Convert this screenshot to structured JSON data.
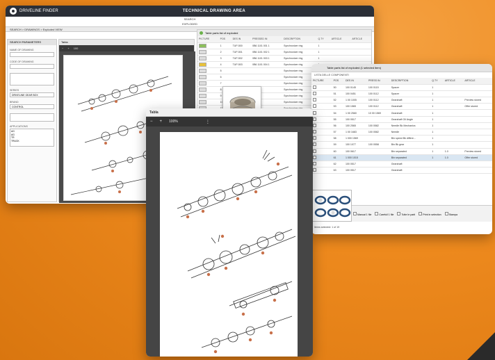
{
  "main": {
    "brand": "DRIVELINE FINDER",
    "title": "TECHNICAL DRAWING AREA",
    "subtitle_1": "SEARCH",
    "subtitle_2": "EXPLODED",
    "breadcrumb": "SEARCH  >  DRAWINGS  >  Exploded VIEW",
    "sidebar": {
      "header": "SEARCH PARAMETERS",
      "fields": [
        "NAME OF DRAWING",
        "CODE OF DRAWING",
        "",
        "SERIES",
        "BRAND",
        ""
      ],
      "series_value": "DRIVELINE GEAR BOX",
      "brand_value": "CONTROL",
      "apps_label": "APPLICATIONS",
      "apps": [
        "AG",
        "AG",
        "TR",
        "TRUCK"
      ]
    },
    "drawing_pane": {
      "tab": "Tabla",
      "zoom": "100"
    },
    "table_pane": {
      "header": "Table parts list of exploded",
      "columns": [
        "PICTURE",
        "POS",
        "DES IN",
        "PRESSED IN",
        "DESCRIPTION",
        "Q.TY",
        "ARTICLE",
        "ARTICLE"
      ],
      "rows": [
        {
          "thumb": "g",
          "pos": "1",
          "des": "TUP-500",
          "code": "0B6 1101 001 1",
          "desc": "Synchronizer ring",
          "qty": "1"
        },
        {
          "thumb": "",
          "pos": "2",
          "des": "TUP-501",
          "code": "0B6 1101 002 1",
          "desc": "Synchronizer ring",
          "qty": "1"
        },
        {
          "thumb": "",
          "pos": "3",
          "des": "TUP-502",
          "code": "0B6 1101 003 1",
          "desc": "Synchronizer ring",
          "qty": "1"
        },
        {
          "thumb": "y",
          "pos": "4",
          "des": "TUP-503",
          "code": "0B6 1101 004 1",
          "desc": "Synchronizer ring",
          "qty": "1"
        },
        {
          "thumb": "",
          "pos": "5",
          "des": "",
          "code": "",
          "desc": "Synchronizer ring",
          "qty": ""
        },
        {
          "thumb": "",
          "pos": "6",
          "des": "",
          "code": "",
          "desc": "Synchronizer ring",
          "qty": ""
        },
        {
          "thumb": "",
          "pos": "7",
          "des": "",
          "code": "",
          "desc": "Synchronizer ring",
          "qty": ""
        },
        {
          "thumb": "",
          "pos": "8",
          "des": "",
          "code": "",
          "desc": "Synchronizer ring",
          "qty": ""
        },
        {
          "thumb": "",
          "pos": "9",
          "des": "",
          "code": "",
          "desc": "Synchronizer ring",
          "qty": ""
        },
        {
          "thumb": "",
          "pos": "10",
          "des": "",
          "code": "",
          "desc": "Synchronizer ring",
          "qty": ""
        },
        {
          "thumb": "",
          "pos": "11",
          "des": "",
          "code": "",
          "desc": "Synchronizer ring",
          "qty": ""
        },
        {
          "thumb": "",
          "pos": "12",
          "des": "",
          "code": "",
          "desc": "Synchronizer ring",
          "qty": ""
        },
        {
          "thumb": "",
          "pos": "13",
          "des": "",
          "code": "",
          "desc": "Synchronizer ring",
          "qty": ""
        }
      ]
    }
  },
  "detail": {
    "header": "Table parts list of exploded (1 selected item)",
    "subheader": "LISTA DELLE COMPONENTI",
    "columns": [
      "PICTURE",
      "POS",
      "DES IN",
      "PRESS IN",
      "DESCRIPTION",
      "Q.TY",
      "ARTICLE",
      "ARTICLE"
    ],
    "rows": [
      {
        "pos": "50",
        "des": "100 0145",
        "press": "100 0115",
        "desc": "Spacer",
        "qty": "1",
        "art1": "",
        "art2": ""
      },
      {
        "pos": "51",
        "des": "100 0451",
        "press": "100 0112",
        "desc": "Spacer",
        "qty": "1",
        "art1": "",
        "art2": ""
      },
      {
        "pos": "52",
        "des": "1 00 1005",
        "press": "100 0112",
        "desc": "Gearshaft",
        "qty": "1",
        "art1": "",
        "art2": "Preview stored"
      },
      {
        "pos": "53",
        "des": "100 1565",
        "press": "100 0112",
        "desc": "Gearshaft",
        "qty": "1",
        "art1": "",
        "art2": "Offer stored"
      },
      {
        "pos": "54",
        "des": "1 00 2560",
        "press": "10 00 1569",
        "desc": "Gearshaft",
        "qty": "1",
        "art1": "",
        "art2": ""
      },
      {
        "pos": "55",
        "des": "100 0517",
        "press": "",
        "desc": "Gearshaft Oil Angle",
        "qty": "1",
        "art1": "",
        "art2": ""
      },
      {
        "pos": "56",
        "des": "100 2565",
        "press": "100 0582",
        "desc": "Needle Bk Mechanics",
        "qty": "1",
        "art1": "",
        "art2": ""
      },
      {
        "pos": "57",
        "des": "1 00 1683",
        "press": "100 0582",
        "desc": "Needle",
        "qty": "1",
        "art1": "",
        "art2": ""
      },
      {
        "pos": "58",
        "des": "1 000 1569",
        "press": "",
        "desc": "Bin speed Bk differe...",
        "qty": "1",
        "art1": "",
        "art2": ""
      },
      {
        "pos": "59",
        "des": "100 1077",
        "press": "100 0558",
        "desc": "Bin Bk gear",
        "qty": "1",
        "art1": "",
        "art2": ""
      },
      {
        "pos": "60",
        "des": "100 0617",
        "press": "",
        "desc": "Bin separated",
        "qty": "1",
        "art1": "1.0",
        "art2": "Preview stored"
      },
      {
        "pos": "61",
        "des": "1 000 1015",
        "press": "",
        "desc": "Bin separated",
        "qty": "1",
        "art1": "1.0",
        "art2": "Offer stored"
      },
      {
        "pos": "62",
        "des": "100 0517",
        "press": "",
        "desc": "Gearshaft",
        "qty": "",
        "art1": "",
        "art2": ""
      },
      {
        "pos": "63",
        "des": "100 0517",
        "press": "",
        "desc": "Gearshaft",
        "qty": "",
        "art1": "",
        "art2": ""
      }
    ],
    "footer_options": [
      "Manual 1 file",
      "Carefull 1 file",
      "Tutte le parti",
      "Print in selection",
      "Stampa"
    ],
    "status": "Items selected: 1 of 19"
  },
  "viewer": {
    "title": "Tabla",
    "minus": "−",
    "plus": "+",
    "zoom": "100%",
    "menu": "⋮"
  },
  "colors": {
    "background": "#ee8a1e",
    "topbar": "#2b2f36",
    "highlight_row": "#d9e6f2",
    "accent_green": "#6bb24a"
  }
}
